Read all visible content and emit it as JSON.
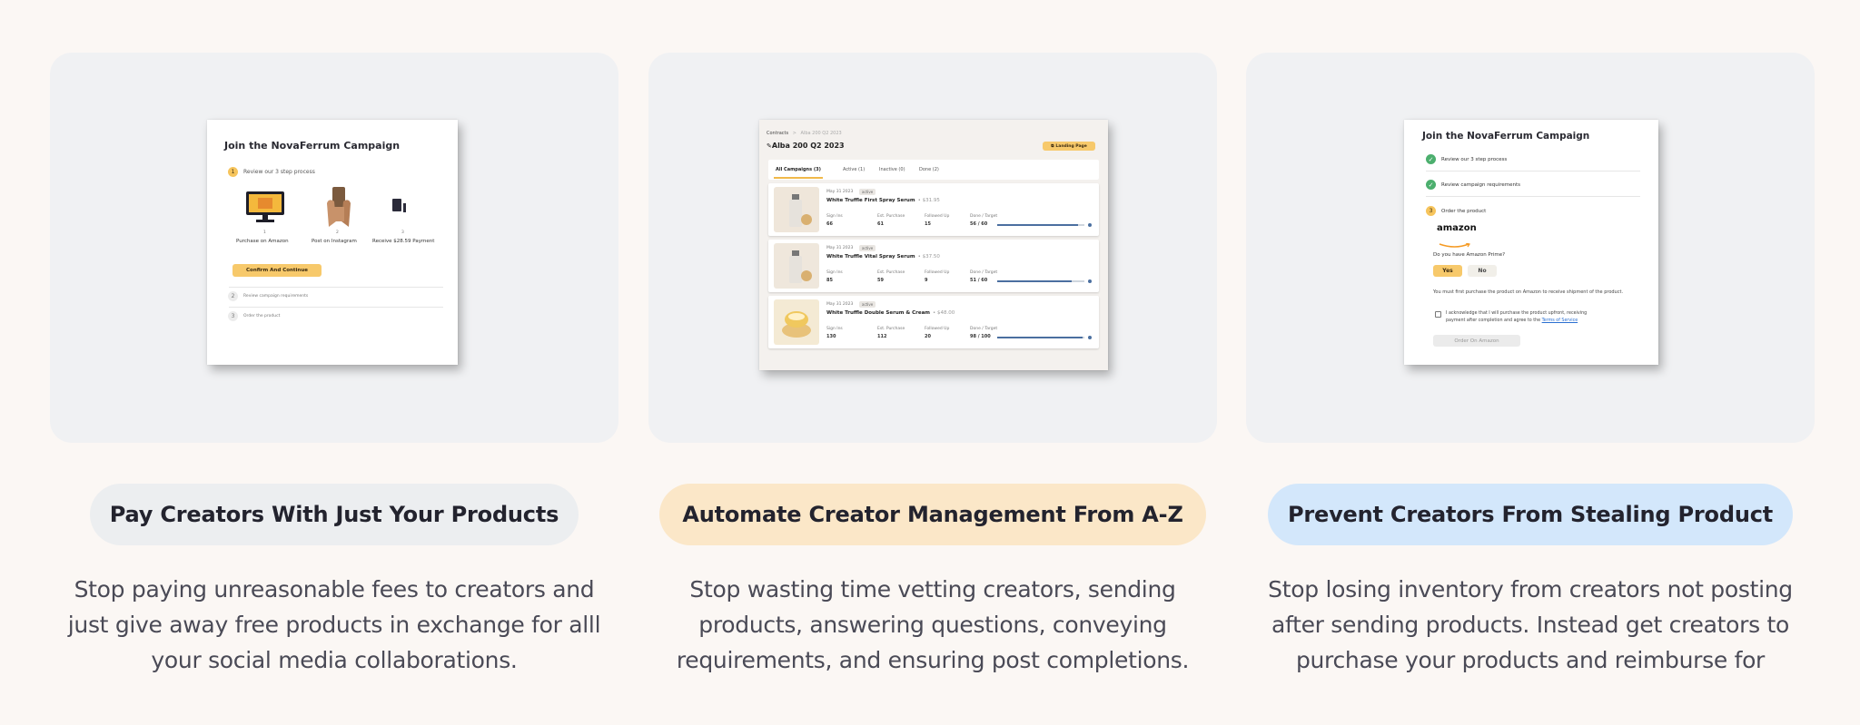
{
  "colors": {
    "page_bg": "#fbf7f4",
    "card_bg": "#f0f1f3",
    "pill_gray": "#eceef0",
    "pill_peach": "#fbe7c8",
    "pill_blue": "#d3e7fb",
    "accent_yellow": "#f7c96b",
    "check_green": "#4caf6e"
  },
  "features": [
    {
      "title": "Pay Creators With Just Your Products",
      "desc_lines": [
        "Stop paying  unreasonable fees to creators and",
        "just give away free products in exchange for alll",
        "your social media collaborations."
      ],
      "screenshot": {
        "heading": "Join the NovaFerrum Campaign",
        "step1_num": "1",
        "step1_label": "Review our 3 step process",
        "steps": [
          {
            "num": "1",
            "label": "Purchase on Amazon",
            "icon": "monitor-icon"
          },
          {
            "num": "2",
            "label": "Post on Instagram",
            "icon": "hands-icon"
          },
          {
            "num": "3",
            "label": "Receive $28.59 Payment",
            "icon": "card-icon"
          }
        ],
        "confirm_button": "Confirm And Continue",
        "step2_num": "2",
        "step2_label": "Review campaign requirements",
        "step3_num": "3",
        "step3_label": "Order the product"
      }
    },
    {
      "title": "Automate Creator Management From A-Z",
      "desc_lines": [
        "Stop wasting time vetting creators, sending",
        "products, answering questions, conveying",
        "requirements, and ensuring post completions."
      ],
      "screenshot": {
        "breadcrumb_root": "Contracts",
        "breadcrumb_sep": ">",
        "breadcrumb_current": "Alba 200 Q2 2023",
        "page_title": "Alba 200 Q2 2023",
        "landing_button": "Landing Page",
        "tabs": [
          "All Campaigns (3)",
          "Active (1)",
          "Inactive (0)",
          "Done (2)"
        ],
        "rows": [
          {
            "date": "May 31 2023",
            "status": "active",
            "name": "White Truffle First Spray Serum",
            "price": "$31.95",
            "metrics": [
              {
                "label": "Sign Ins",
                "value": "66"
              },
              {
                "label": "Est. Purchase",
                "value": "61"
              },
              {
                "label": "Followed Up",
                "value": "15"
              },
              {
                "label": "Done / Target",
                "value": "56 / 60"
              }
            ],
            "progress": 0.93
          },
          {
            "date": "May 31 2023",
            "status": "active",
            "name": "White Truffle Vital Spray Serum",
            "price": "$37.50",
            "metrics": [
              {
                "label": "Sign Ins",
                "value": "85"
              },
              {
                "label": "Est. Purchase",
                "value": "59"
              },
              {
                "label": "Followed Up",
                "value": "9"
              },
              {
                "label": "Done / Target",
                "value": "51 / 60"
              }
            ],
            "progress": 0.85
          },
          {
            "date": "May 31 2023",
            "status": "active",
            "name": "White Truffle Double Serum & Cream",
            "price": "$48.00",
            "metrics": [
              {
                "label": "Sign Ins",
                "value": "130"
              },
              {
                "label": "Est. Purchase",
                "value": "112"
              },
              {
                "label": "Followed Up",
                "value": "20"
              },
              {
                "label": "Done / Target",
                "value": "98 / 100"
              }
            ],
            "progress": 0.98
          }
        ]
      }
    },
    {
      "title": "Prevent Creators From Stealing Product",
      "desc_lines": [
        "Stop losing inventory from creators not posting",
        "after sending products. Instead get creators to",
        "purchase your products and reimburse for"
      ],
      "screenshot": {
        "heading": "Join the NovaFerrum Campaign",
        "done1": "Review our 3 step process",
        "done2": "Review campaign requirements",
        "step3_num": "3",
        "step3_label": "Order the product",
        "brand": "amazon",
        "question": "Do you have Amazon Prime?",
        "yes": "Yes",
        "no": "No",
        "note": "You must first purchase the product on Amazon to receive shipment of the product.",
        "ack_1": "I acknowledge that I will purchase the product upfront, receiving",
        "ack_2": "payment after completion and agree to the",
        "terms_link": "Terms of Service",
        "order_button": "Order On Amazon"
      }
    }
  ]
}
